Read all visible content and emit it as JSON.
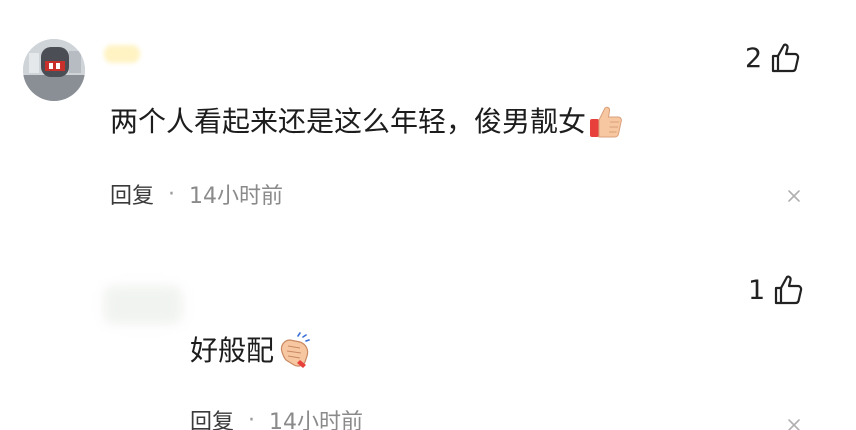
{
  "comments": [
    {
      "likes": "2",
      "text": "两个人看起来还是这么年轻，俊男靓女",
      "emoji": "thumbs-up-icon",
      "reply_label": "回复",
      "separator": "·",
      "time": "14小时前"
    },
    {
      "likes": "1",
      "text": "好般配",
      "emoji": "clapping-hands-icon",
      "reply_label": "回复",
      "separator": "·",
      "time": "14小时前"
    }
  ],
  "colors": {
    "text": "#1d1d1d",
    "meta": "#8a8a8a",
    "background": "#ffffff"
  }
}
